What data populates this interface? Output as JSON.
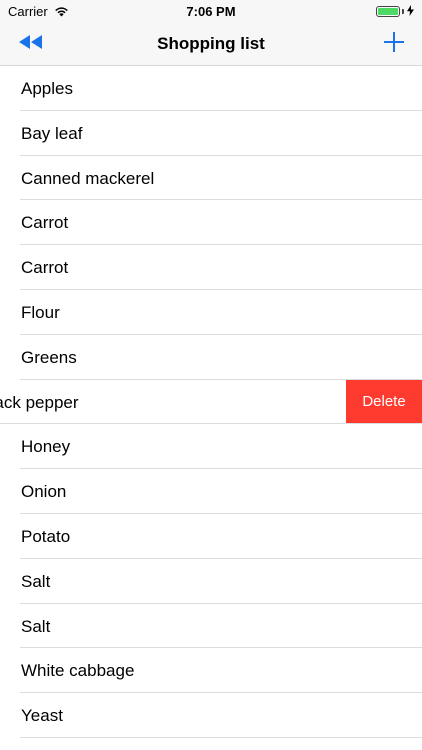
{
  "status_bar": {
    "carrier": "Carrier",
    "time": "7:06 PM",
    "battery_color": "#4cd964"
  },
  "nav": {
    "back_icon": "rewind-icon",
    "title": "Shopping list",
    "add_icon": "plus-icon",
    "accent_color": "#1a73e8"
  },
  "items": [
    {
      "label": "Apples"
    },
    {
      "label": "Bay leaf"
    },
    {
      "label": "Canned mackerel"
    },
    {
      "label": "Carrot"
    },
    {
      "label": "Carrot"
    },
    {
      "label": "Flour"
    },
    {
      "label": "Greens"
    },
    {
      "label": "d black pepper",
      "swiped": true,
      "action": "Delete"
    },
    {
      "label": "Honey"
    },
    {
      "label": "Onion"
    },
    {
      "label": "Potato"
    },
    {
      "label": "Salt"
    },
    {
      "label": "Salt"
    },
    {
      "label": "White cabbage"
    },
    {
      "label": "Yeast"
    }
  ],
  "delete_color": "#ff3b30"
}
